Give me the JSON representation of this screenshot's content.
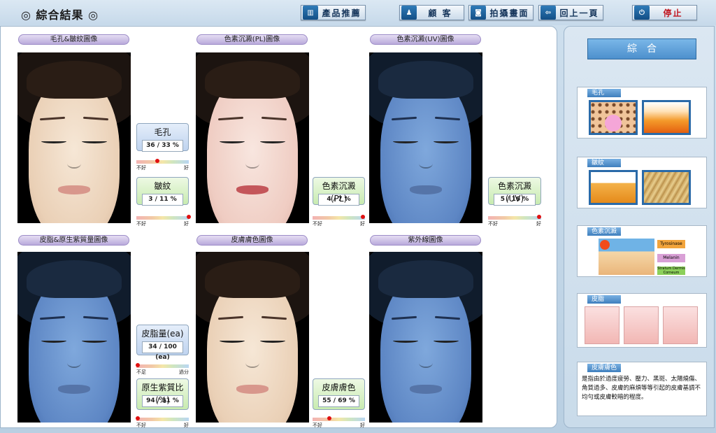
{
  "header": {
    "title": "◎ 綜合結果 ◎",
    "buttons": {
      "recommend": "產品推薦",
      "customer": "顧 客",
      "capture": "拍攝畫面",
      "back": "回上一頁",
      "stop": "停止"
    }
  },
  "images": {
    "pores_wrinkles": "毛孔&皺紋圖像",
    "pigment_pl": "色素沉澱(PL)圖像",
    "pigment_uv": "色素沉澱(UV)圖像",
    "sebum_porphyrin": "皮脂&原生紫質量圖像",
    "skin_tone": "皮膚膚色圖像",
    "ultraviolet": "紫外線圖像"
  },
  "metrics": {
    "pores": {
      "label": "毛孔",
      "value": "36 / 33 %",
      "low": "不好",
      "high": "好",
      "level": 0.4
    },
    "wrinkles": {
      "label": "皺紋",
      "value": "3 / 11 %",
      "low": "不好",
      "high": "好",
      "level": 1.0
    },
    "pigment_pl": {
      "label": "色素沉澱(PL)",
      "value": "4 / 7 %",
      "low": "不好",
      "high": "好",
      "level": 0.96
    },
    "pigment_uv": {
      "label": "色素沉澱(UV)",
      "value": "5 / 16 %",
      "low": "不好",
      "high": "好",
      "level": 0.96
    },
    "sebum": {
      "label": "皮脂量(ea)",
      "value": "34 / 100 (ea)",
      "low": "不足",
      "high": "過分",
      "level": 0.02
    },
    "porphyrin": {
      "label": "原生紫質比(%)",
      "value": "94 / 31 %",
      "low": "不好",
      "high": "好",
      "level": 0.02
    },
    "skin_tone": {
      "label": "皮膚膚色",
      "value": "55 / 69 %",
      "low": "不好",
      "high": "好",
      "level": 0.32
    }
  },
  "side": {
    "title": "綜合",
    "cards": {
      "pores": "毛孔",
      "wrinkles": "皺紋",
      "pigment": "色素沉澱",
      "pigment_tags": {
        "tyrosinase": "Tyrosinase",
        "melanin": "Melanin",
        "layers": "Stratum Dermis Corneum"
      },
      "sebum": "皮脂",
      "skin_tone": "皮膚膚色",
      "skin_tone_desc": "是指由於過度疲勞、壓力、黑斑、太陽燒傷、角質過多、皮膚的麻煩等等引起的皮膚基調不均勻或皮膚較暗的程度。"
    }
  },
  "colors": {
    "stop_text": "#c0141e",
    "accent": "#4d90cd",
    "scale_dot": "#e01010"
  }
}
